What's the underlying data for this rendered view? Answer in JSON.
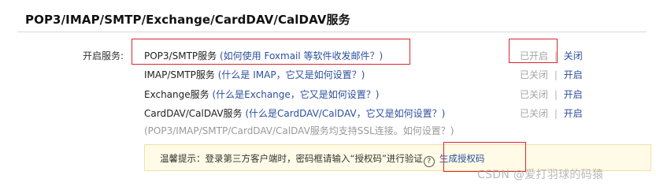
{
  "section": {
    "title": "POP3/IMAP/SMTP/Exchange/CardDAV/CalDAV服务"
  },
  "services_label": "开启服务:",
  "services": [
    {
      "name": "POP3/SMTP服务",
      "help": "(如何使用 Foxmail 等软件收发邮件？)",
      "status": "已开启",
      "separator": "|",
      "action": "关闭"
    },
    {
      "name": "IMAP/SMTP服务",
      "help": "(什么是 IMAP，它又是如何设置？)",
      "status": "已关闭",
      "separator": "|",
      "action": "开启"
    },
    {
      "name": "Exchange服务",
      "help": "(什么是Exchange，它又是如何设置？)",
      "status": "已关闭",
      "separator": "|",
      "action": "开启"
    },
    {
      "name": "CardDAV/CalDAV服务",
      "help": "(什么是CardDAV/CalDAV，它又是如何设置？)",
      "status": "已关闭",
      "separator": "|",
      "action": "开启"
    }
  ],
  "ssl_note": {
    "text": "(POP3/IMAP/SMTP/CardDAV/CalDAV服务均支持SSL连接。",
    "link": "如何设置？)"
  },
  "tip": {
    "text": "温馨提示：登录第三方客户端时，密码框请输入“授权码”进行验证",
    "help_glyph": "?",
    "link": "生成授权码"
  },
  "watermark": "CSDN @爱打羽球的码猿",
  "colors": {
    "link": "#2b4f9e",
    "muted": "#a5a5a5",
    "tip_bg": "#fffbe6",
    "highlight_box": "#d9262c"
  }
}
